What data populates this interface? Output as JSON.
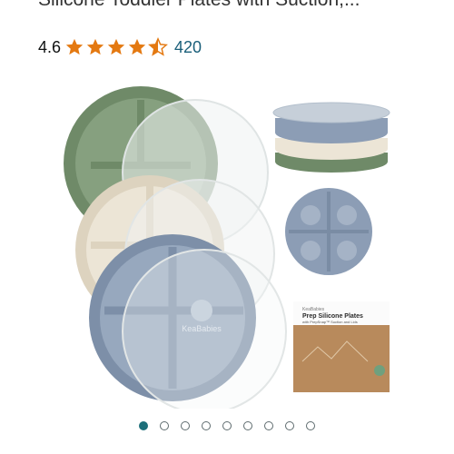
{
  "product": {
    "title": "Silicone Toddler Plates with Suction,...",
    "rating": "4.6",
    "rating_value": 4.6,
    "review_count": "420",
    "star_color": "#e47911"
  },
  "image": {
    "brand_text": "KeaBabies",
    "box_title": "Prep Silicone Plates",
    "box_subtitle": "with PrepSnap™ Suction and Lids",
    "colors": {
      "sage": "#6f8a68",
      "cream": "#ece5d6",
      "blue": "#8c9db5",
      "lid": "#e8ecee"
    }
  },
  "carousel": {
    "total": 9,
    "active_index": 0
  }
}
